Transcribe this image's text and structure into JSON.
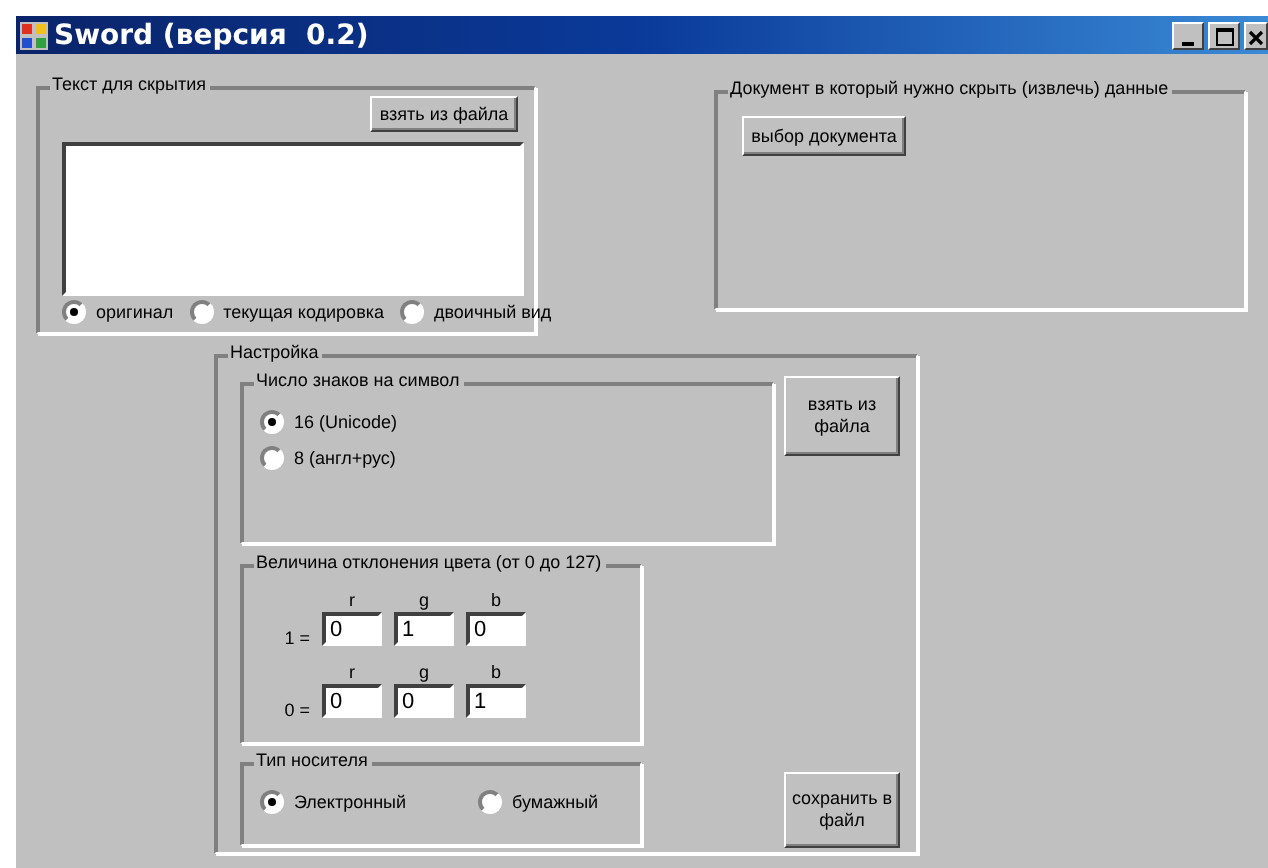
{
  "window": {
    "title": "Sword (версия  0.2)"
  },
  "text_group": {
    "title": "Текст для скрытия",
    "load_button": "взять из файла",
    "modes": [
      {
        "label": "оригинал",
        "selected": true
      },
      {
        "label": "текущая кодировка",
        "selected": false
      },
      {
        "label": "двоичный вид",
        "selected": false
      }
    ]
  },
  "document_group": {
    "title": "Документ в который нужно скрыть (извлечь) данные",
    "select_button": "выбор документа"
  },
  "settings": {
    "title": "Настройка",
    "chars_group": {
      "title": "Число знаков на символ",
      "options": [
        {
          "label": "16 (Unicode)",
          "selected": true
        },
        {
          "label": "8 (англ+рус)",
          "selected": false
        }
      ]
    },
    "load_button": "взять из файла",
    "deviation_group": {
      "title": "Величина отклонения цвета (от 0 до 127)",
      "rows": [
        {
          "label": "1 =",
          "fields": [
            {
              "label": "r",
              "value": "0"
            },
            {
              "label": "g",
              "value": "1"
            },
            {
              "label": "b",
              "value": "0"
            }
          ]
        },
        {
          "label": "0 =",
          "fields": [
            {
              "label": "r",
              "value": "0"
            },
            {
              "label": "g",
              "value": "0"
            },
            {
              "label": "b",
              "value": "1"
            }
          ]
        }
      ]
    },
    "media_group": {
      "title": "Тип носителя",
      "options": [
        {
          "label": "Электронный",
          "selected": true
        },
        {
          "label": "бумажный",
          "selected": false
        }
      ]
    },
    "save_button": "сохранить в файл"
  }
}
